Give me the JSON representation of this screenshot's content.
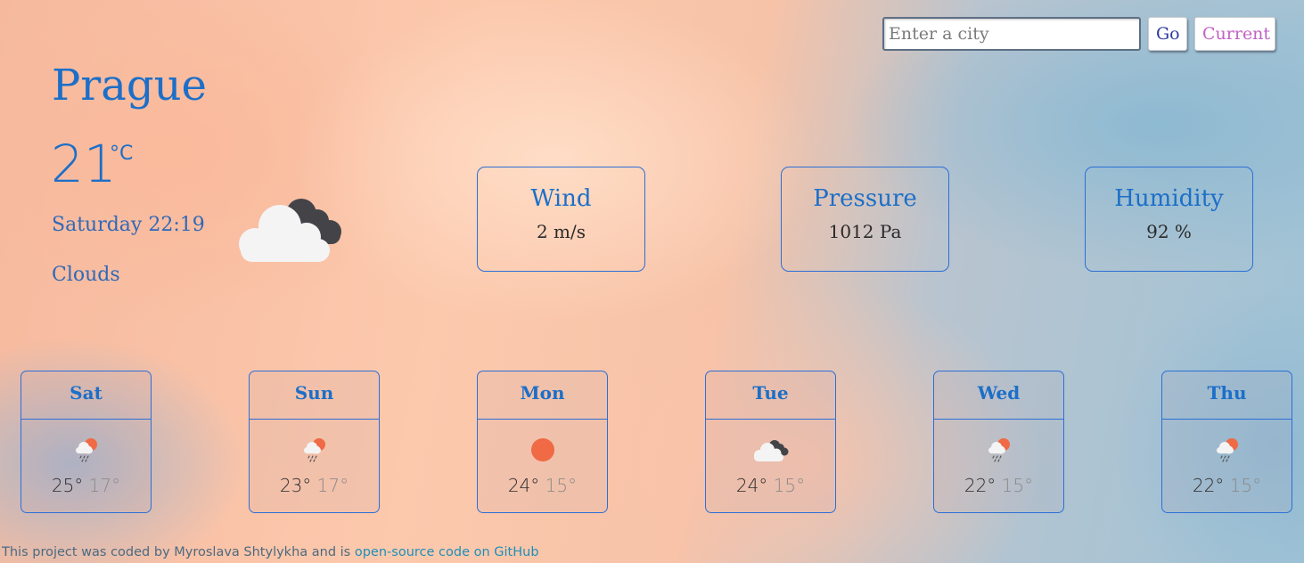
{
  "search": {
    "placeholder": "Enter a city",
    "value": "",
    "go_label": "Go",
    "current_label": "Current"
  },
  "current": {
    "city": "Prague",
    "temperature": "21",
    "unit": "°C",
    "datetime": "Saturday 22:19",
    "description": "Clouds",
    "icon": "broken-clouds-icon"
  },
  "stats": [
    {
      "label": "Wind",
      "value": "2 m/s"
    },
    {
      "label": "Pressure",
      "value": "1012 Pa"
    },
    {
      "label": "Humidity",
      "value": "92 %"
    }
  ],
  "forecast": [
    {
      "day": "Sat",
      "icon": "rain-sun-icon",
      "max": "25°",
      "min": "17°"
    },
    {
      "day": "Sun",
      "icon": "rain-sun-icon",
      "max": "23°",
      "min": "17°"
    },
    {
      "day": "Mon",
      "icon": "sun-icon",
      "max": "24°",
      "min": "15°"
    },
    {
      "day": "Tue",
      "icon": "broken-clouds-icon",
      "max": "24°",
      "min": "15°"
    },
    {
      "day": "Wed",
      "icon": "rain-sun-icon",
      "max": "22°",
      "min": "15°"
    },
    {
      "day": "Thu",
      "icon": "rain-sun-icon",
      "max": "22°",
      "min": "15°"
    }
  ],
  "footer": {
    "text": "This project was coded by Myroslava Shtylykha and is ",
    "link_label": "open-source code on GitHub"
  },
  "colors": {
    "accent": "#1c6fc8",
    "border": "#2c6fd6",
    "sun": "#ef6a45",
    "cloud_dark": "#444448",
    "cloud_light": "#f4f4f4"
  }
}
